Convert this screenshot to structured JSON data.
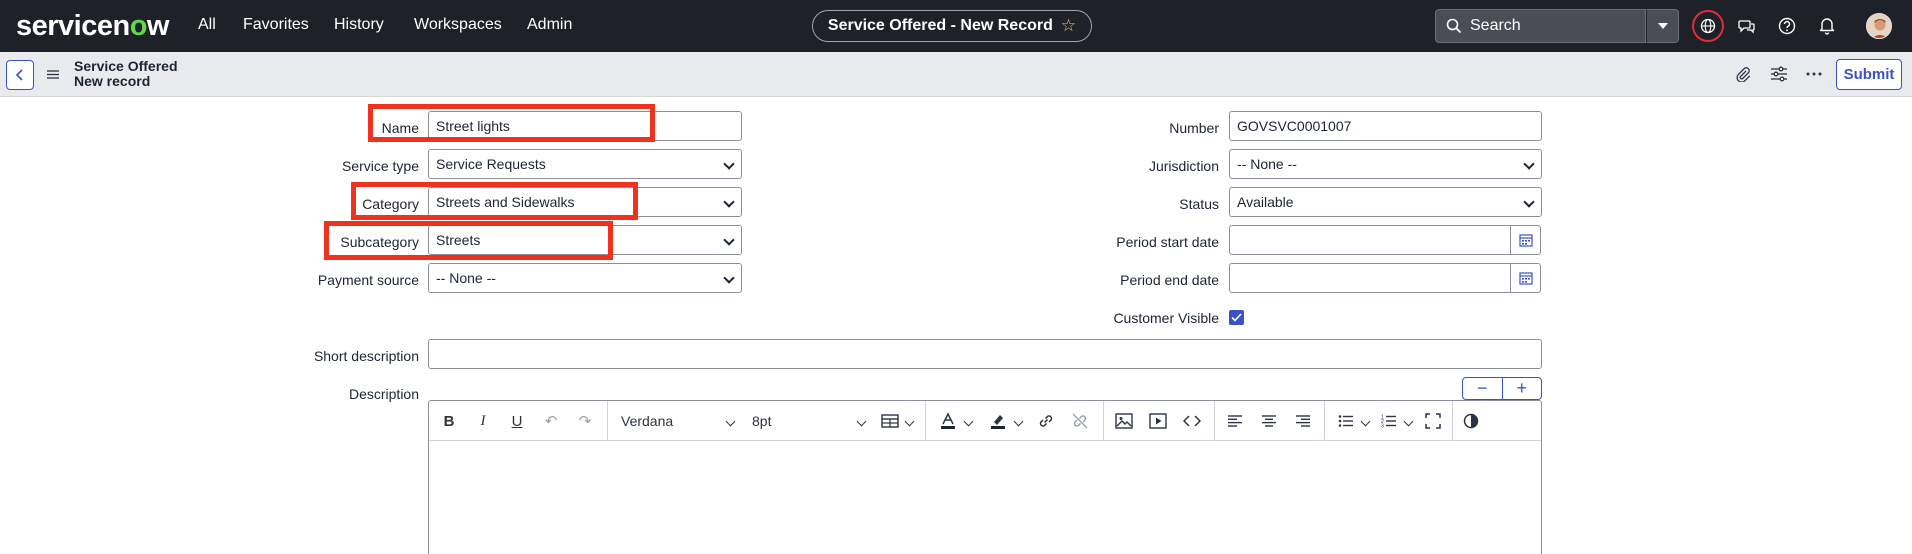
{
  "nav": {
    "logo_pre": "servicen",
    "logo_o": "o",
    "logo_post": "w",
    "items": [
      "All",
      "Favorites",
      "History",
      "Workspaces",
      "Admin"
    ],
    "record_title": "Service Offered - New Record",
    "search_placeholder": "Search"
  },
  "subheader": {
    "title": "Service Offered",
    "subtitle": "New record",
    "submit_label": "Submit"
  },
  "form": {
    "name": {
      "label": "Name",
      "value": "Street lights"
    },
    "service_type": {
      "label": "Service type",
      "value": "Service Requests"
    },
    "category": {
      "label": "Category",
      "value": "Streets and Sidewalks"
    },
    "subcategory": {
      "label": "Subcategory",
      "value": "Streets"
    },
    "payment_source": {
      "label": "Payment source",
      "value": "-- None --"
    },
    "number": {
      "label": "Number",
      "value": "GOVSVC0001007"
    },
    "jurisdiction": {
      "label": "Jurisdiction",
      "value": "-- None --"
    },
    "status": {
      "label": "Status",
      "value": "Available"
    },
    "period_start": {
      "label": "Period start date",
      "value": ""
    },
    "period_end": {
      "label": "Period end date",
      "value": ""
    },
    "customer_visible": {
      "label": "Customer Visible",
      "checked": true
    },
    "short_description": {
      "label": "Short description",
      "value": ""
    },
    "description": {
      "label": "Description"
    }
  },
  "editor": {
    "font_family": "Verdana",
    "font_size": "8pt"
  },
  "colors": {
    "nav_bg": "#1f2129",
    "accent": "#3a52c7",
    "highlight": "#f0311e",
    "logo_green": "#62d84e"
  }
}
